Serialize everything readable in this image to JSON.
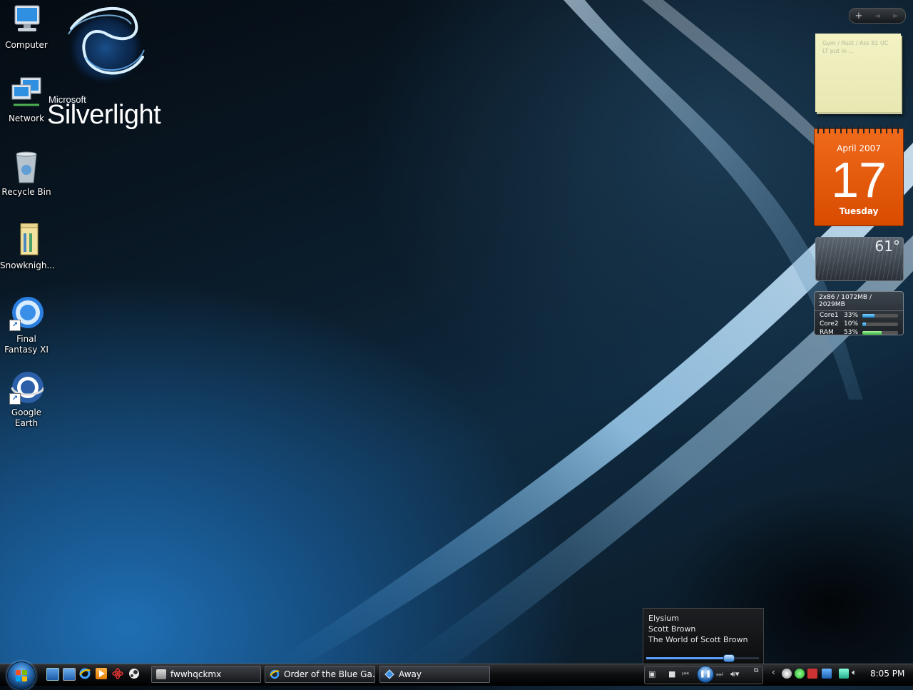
{
  "desktop": {
    "icons": [
      {
        "label": "Computer",
        "icon": "computer-icon"
      },
      {
        "label": "Network",
        "icon": "network-icon"
      },
      {
        "label": "Recycle Bin",
        "icon": "recycle-bin-icon"
      },
      {
        "label": "Snowknigh...",
        "icon": "folder-icon"
      },
      {
        "label": "Final Fantasy XI",
        "icon": "final-fantasy-icon"
      },
      {
        "label": "Google Earth",
        "icon": "google-earth-icon"
      }
    ],
    "logo": {
      "brand": "Microsoft",
      "product": "Silverlight"
    }
  },
  "sidebar": {
    "controls": {
      "add": "+",
      "prev": "◄",
      "next": "►"
    },
    "notes": {
      "text": "Gym / Rust / Ass 81 UC LT put in ..."
    },
    "calendar": {
      "month_year": "April 2007",
      "day": "17",
      "weekday": "Tuesday"
    },
    "weather": {
      "temperature": "61°"
    },
    "cpu_meter": {
      "header": "2x86 / 1072MB / 2029MB",
      "rows": [
        {
          "name": "Core1",
          "percent": "33%",
          "value": 0.33
        },
        {
          "name": "Core2",
          "percent": "10%",
          "value": 0.1
        },
        {
          "name": "RAM",
          "percent": "53%",
          "value": 0.53
        }
      ]
    }
  },
  "media_popup": {
    "track": "Elysium",
    "artist": "Scott Brown",
    "album": "The World of Scott Brown",
    "progress": 0.72
  },
  "taskbar": {
    "buttons": [
      {
        "label": "fwwhqckmx",
        "icon": "archive-icon"
      },
      {
        "label": "Order of the Blue Ga...",
        "icon": "internet-explorer-icon"
      },
      {
        "label": "Away",
        "icon": "messenger-icon"
      }
    ],
    "clock": "8:05 PM"
  },
  "colors": {
    "calendar": "#e8580c",
    "accent": "#1f6fb4"
  }
}
